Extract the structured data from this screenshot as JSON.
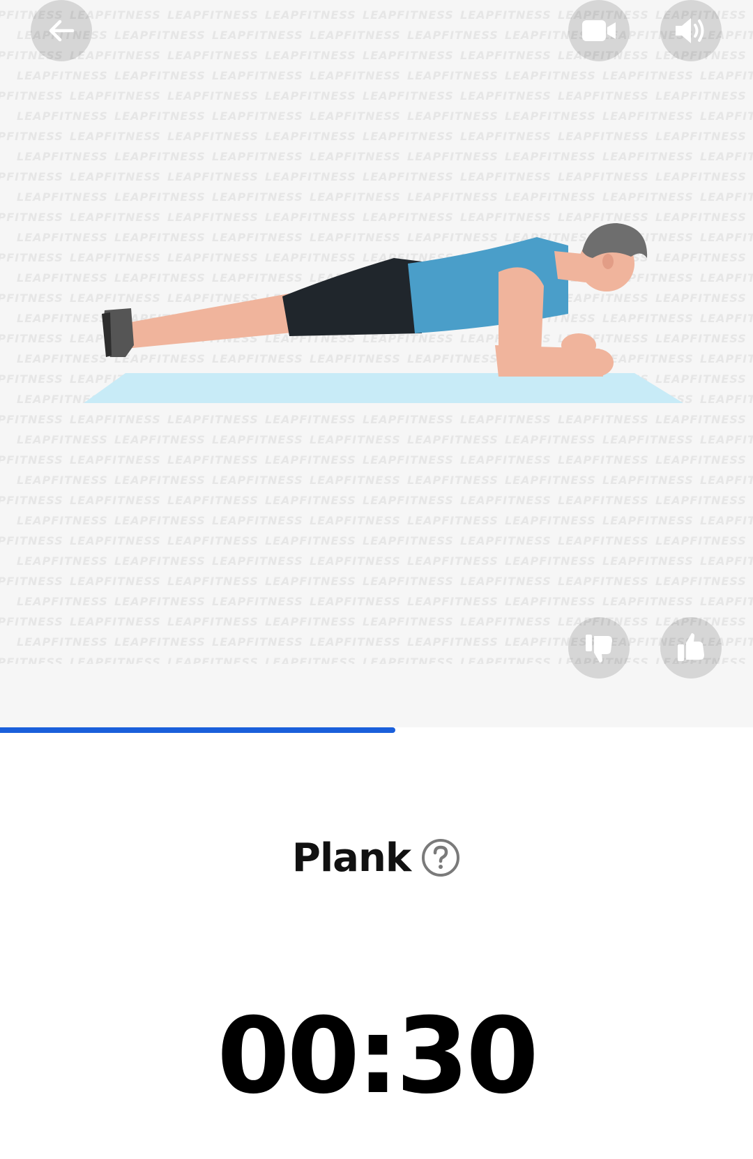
{
  "watermark": {
    "text": "LEAPFITNESS"
  },
  "illustration": {
    "exercise_figure": "plank-illustration",
    "mat_color": "#c8ebf7",
    "shirt_color": "#4a9ec9"
  },
  "top_bar": {
    "back_icon": "arrow-left-icon",
    "video_icon": "video-camera-icon",
    "sound_icon": "speaker-icon"
  },
  "feedback": {
    "dislike_icon": "thumbs-down-icon",
    "like_icon": "thumbs-up-icon"
  },
  "progress": {
    "fraction": 0.525,
    "color": "#1a5fdb"
  },
  "exercise": {
    "name": "Plank",
    "help_icon": "question-circle-icon"
  },
  "timer": {
    "value": "00:30"
  }
}
